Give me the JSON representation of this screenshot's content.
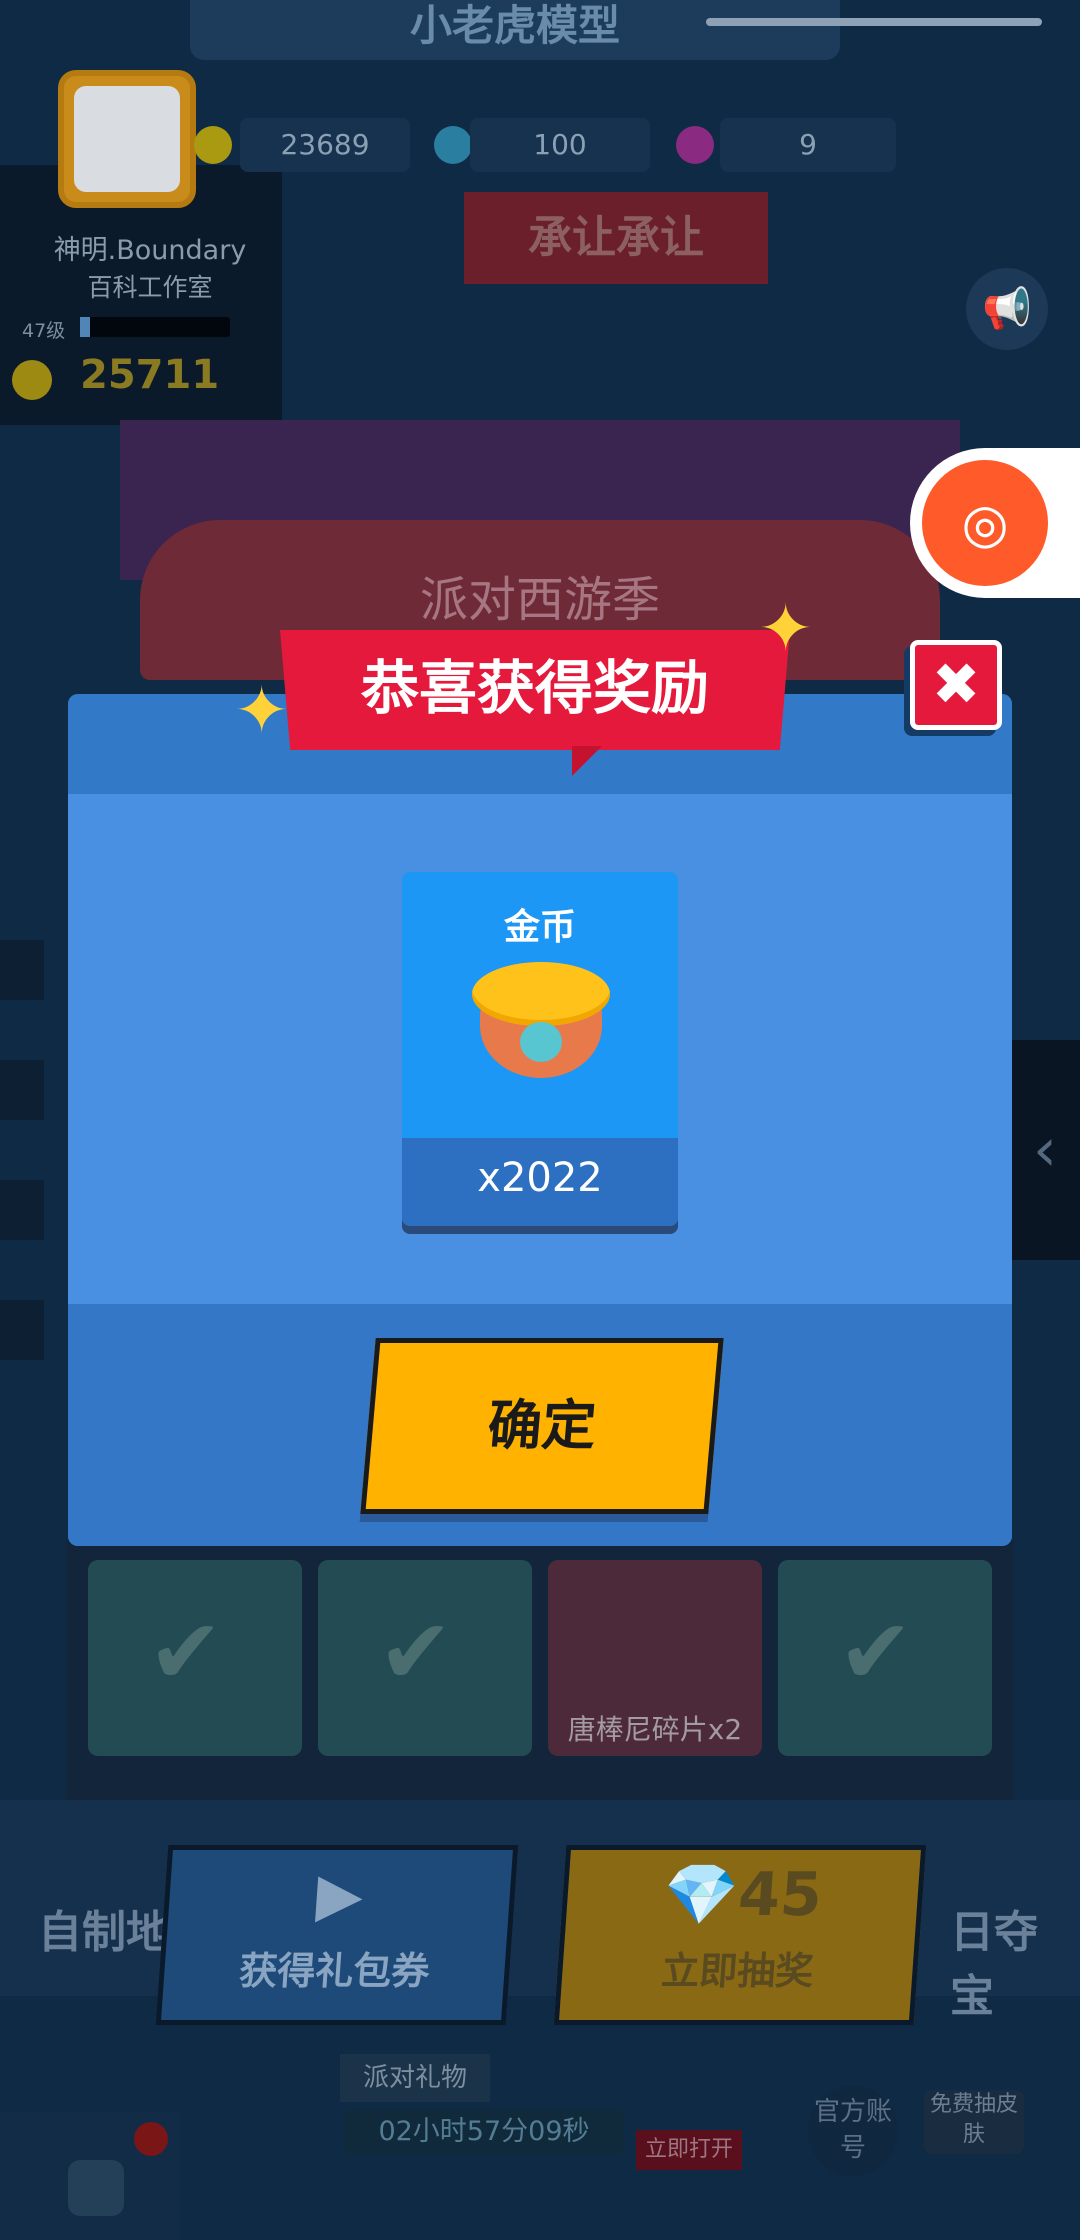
{
  "header": {
    "title": "小老虎模型"
  },
  "profile": {
    "name": "神明.Boundary",
    "studio": "百科工作室",
    "level": "47级",
    "coins": "25711"
  },
  "resources": {
    "gold": "23689",
    "diamond": "100",
    "flower": "9"
  },
  "speech_bubble": "承让承让",
  "party_banner": "派对西游季",
  "dialog": {
    "title": "恭喜获得奖励",
    "close_icon": "✖",
    "reward": {
      "name": "金币",
      "quantity": "x2022",
      "icon": "gold-coin-bag-icon"
    },
    "confirm_label": "确定"
  },
  "cards": {
    "card3_label": "唐棒尼碎片x2"
  },
  "bottom": {
    "left_label": "自制地",
    "coupon_label": "获得礼包券",
    "draw_count": "45",
    "draw_label": "立即抽奖",
    "right_label": "日夺宝",
    "gift_label": "派对礼物",
    "timer": "02小时57分09秒",
    "open_label": "立即打开",
    "official_label": "官方账号",
    "free_skin_label": "免费抽皮肤"
  },
  "colors": {
    "dialog": "#4a90e2",
    "ribbon": "#e5193c",
    "confirm": "#ffb300",
    "item_card": "#1c97f5"
  }
}
